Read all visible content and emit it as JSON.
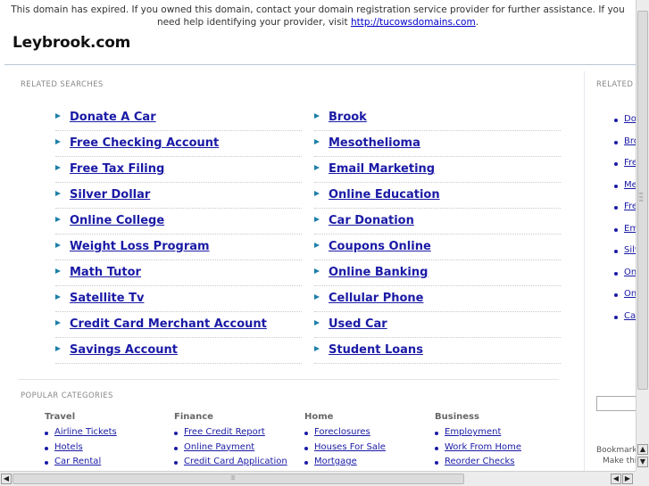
{
  "expiry": {
    "text": "This domain has expired. If you owned this domain, contact your domain registration service provider for further assistance. If you need help identifying your provider, visit ",
    "link": "http://tucowsdomains.com",
    "end": "."
  },
  "site": {
    "title": "Leybrook.com"
  },
  "related": {
    "heading": "RELATED SEARCHES",
    "left": [
      "Donate A Car",
      "Free Checking Account",
      "Free Tax Filing",
      "Silver Dollar",
      "Online College",
      "Weight Loss Program",
      "Math Tutor",
      "Satellite Tv",
      "Credit Card Merchant Account",
      "Savings Account"
    ],
    "right": [
      "Brook",
      "Mesothelioma",
      "Email Marketing",
      "Online Education",
      "Car Donation",
      "Coupons Online",
      "Online Banking",
      "Cellular Phone",
      "Used Car",
      "Student Loans"
    ]
  },
  "popular": {
    "heading": "POPULAR CATEGORIES",
    "categories": [
      {
        "title": "Travel",
        "items": [
          "Airline Tickets",
          "Hotels",
          "Car Rental"
        ]
      },
      {
        "title": "Finance",
        "items": [
          "Free Credit Report",
          "Online Payment",
          "Credit Card Application"
        ]
      },
      {
        "title": "Home",
        "items": [
          "Foreclosures",
          "Houses For Sale",
          "Mortgage"
        ]
      },
      {
        "title": "Business",
        "items": [
          "Employment",
          "Work From Home",
          "Reorder Checks"
        ]
      }
    ]
  },
  "side": {
    "heading": "RELATED",
    "items": [
      "Do",
      "Bro",
      "Fre",
      "Me",
      "Fre",
      "Em",
      "Silv",
      "On",
      "On",
      "Ca"
    ],
    "bookmark_line1": "Bookmark",
    "bookmark_line2": "Make this"
  },
  "colors": {
    "link": "#1a1aa6",
    "arrow": "#1e7fa8",
    "rule": "#b9c7d4"
  }
}
